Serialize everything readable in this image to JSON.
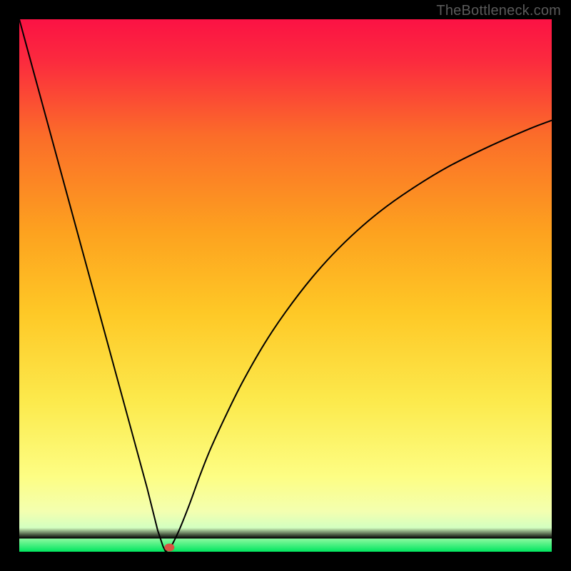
{
  "watermark": "TheBottleneck.com",
  "colors": {
    "gradient_top": "#fb1244",
    "gradient_mid_top": "#fb6d29",
    "gradient_mid": "#fec826",
    "gradient_mid_bottom": "#fdfe84",
    "gradient_bottom": "#00e65f",
    "line": "#000000",
    "marker": "#d95343",
    "frame": "#000000"
  },
  "chart_data": {
    "type": "line",
    "title": "",
    "xlabel": "",
    "ylabel": "",
    "xlim": [
      0,
      100
    ],
    "ylim": [
      0,
      100
    ],
    "grid": false,
    "legend": false,
    "series": [
      {
        "name": "left-branch",
        "x": [
          0,
          3,
          6,
          9,
          12,
          15,
          18,
          21,
          24,
          26,
          27,
          27.5
        ],
        "values": [
          100,
          89,
          78,
          67,
          56,
          45,
          34,
          23,
          12,
          4,
          1,
          0
        ]
      },
      {
        "name": "right-branch",
        "x": [
          27.5,
          28.5,
          30,
          32,
          34,
          36,
          39,
          42,
          46,
          50,
          55,
          60,
          66,
          72,
          80,
          88,
          96,
          100
        ],
        "values": [
          0,
          1,
          4,
          9,
          14.5,
          19.5,
          26,
          32,
          39,
          45,
          51.5,
          57,
          62.5,
          67,
          72,
          76,
          79.5,
          81
        ]
      }
    ],
    "marker": {
      "x": 28.2,
      "y": 0.8,
      "color": "#d95343"
    }
  }
}
